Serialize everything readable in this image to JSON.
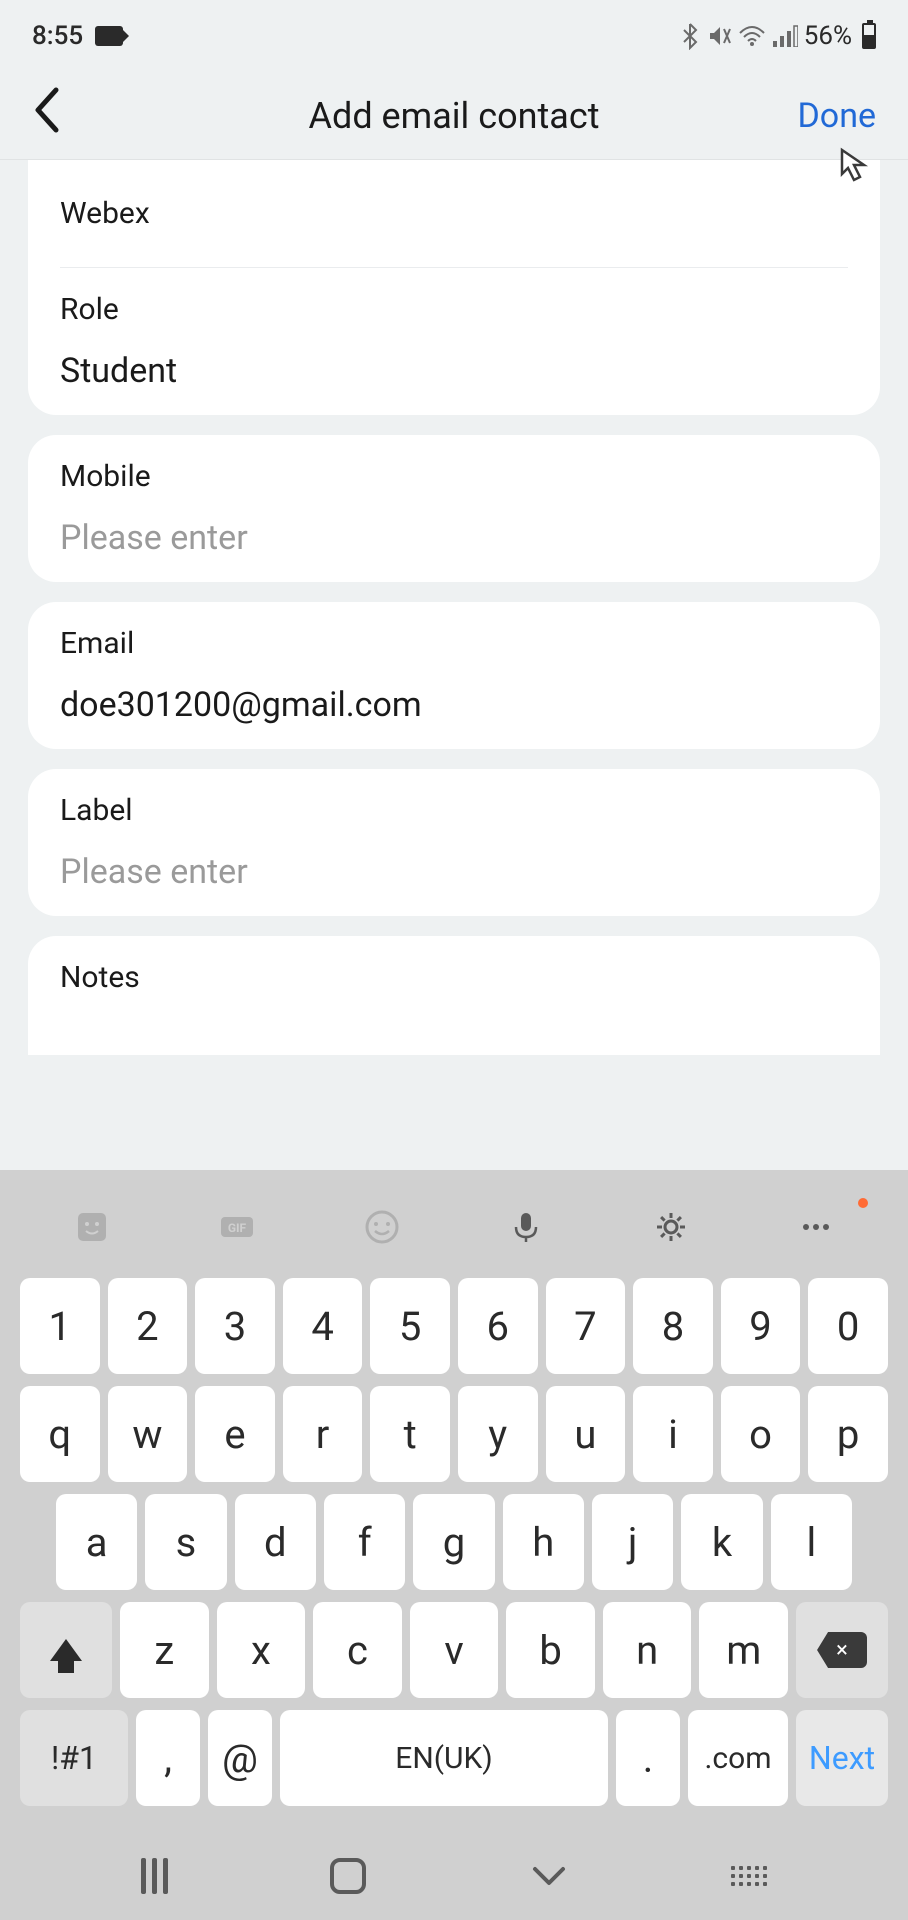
{
  "statusBar": {
    "time": "8:55",
    "batteryPercent": "56%"
  },
  "appBar": {
    "title": "Add email contact",
    "doneLabel": "Done"
  },
  "form": {
    "webex": {
      "label": "Webex"
    },
    "role": {
      "label": "Role",
      "value": "Student"
    },
    "mobile": {
      "label": "Mobile",
      "placeholder": "Please enter",
      "value": ""
    },
    "email": {
      "label": "Email",
      "value": "doe301200@gmail.com"
    },
    "labelField": {
      "label": "Label",
      "placeholder": "Please enter",
      "value": ""
    },
    "notes": {
      "label": "Notes"
    }
  },
  "keyboard": {
    "row1": [
      "1",
      "2",
      "3",
      "4",
      "5",
      "6",
      "7",
      "8",
      "9",
      "0"
    ],
    "row2": [
      "q",
      "w",
      "e",
      "r",
      "t",
      "y",
      "u",
      "i",
      "o",
      "p"
    ],
    "row3": [
      "a",
      "s",
      "d",
      "f",
      "g",
      "h",
      "j",
      "k",
      "l"
    ],
    "row4": [
      "z",
      "x",
      "c",
      "v",
      "b",
      "n",
      "m"
    ],
    "symKey": "!#1",
    "comma": ",",
    "at": "@",
    "space": "EN(UK)",
    "dot": ".",
    "com": ".com",
    "next": "Next"
  }
}
